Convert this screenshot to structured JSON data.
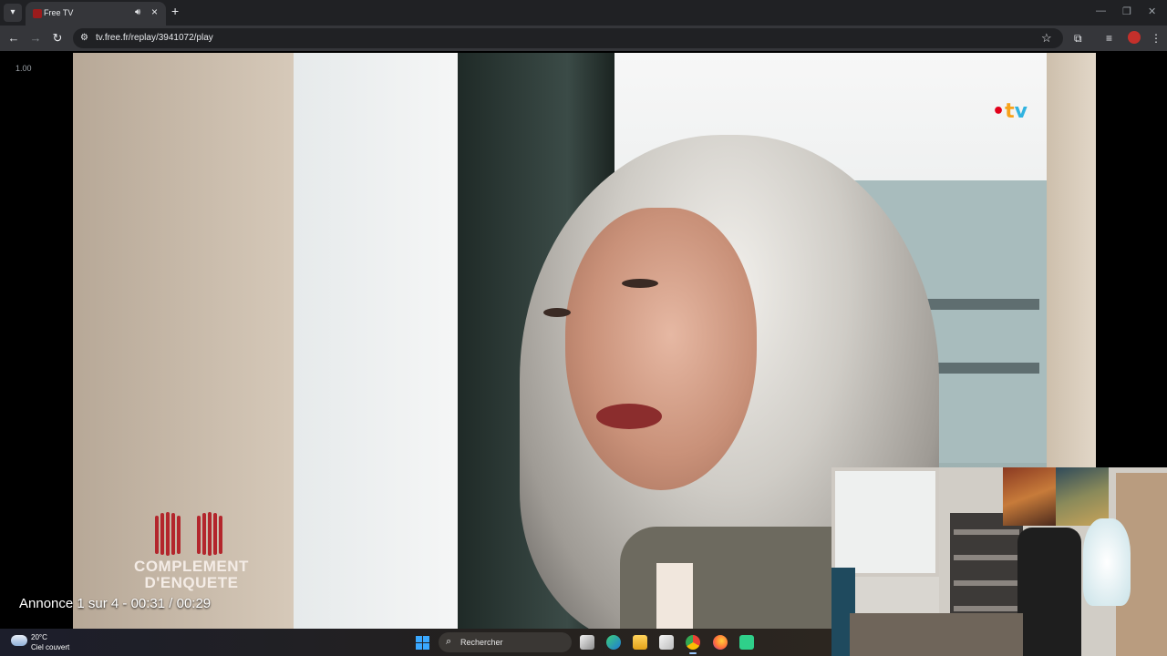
{
  "browser": {
    "tab": {
      "title": "Free TV"
    },
    "url": "tv.free.fr/replay/3941072/play"
  },
  "player": {
    "speed": "1.00",
    "channel_logo": {
      "dot": "•",
      "t": "t",
      "v": "v"
    },
    "show_logo": {
      "line1": "COMPLEMENT",
      "line2": "D'ENQUETE"
    },
    "ad_status": "Annonce 1 sur 4 - 00:31 / 00:29"
  },
  "taskbar": {
    "weather": {
      "temperature": "20°C",
      "condition": "Ciel couvert"
    },
    "search_placeholder": "Rechercher",
    "apps": [
      "task-view",
      "edge",
      "file-explorer",
      "microsoft-store",
      "chrome",
      "firefox",
      "app"
    ]
  }
}
